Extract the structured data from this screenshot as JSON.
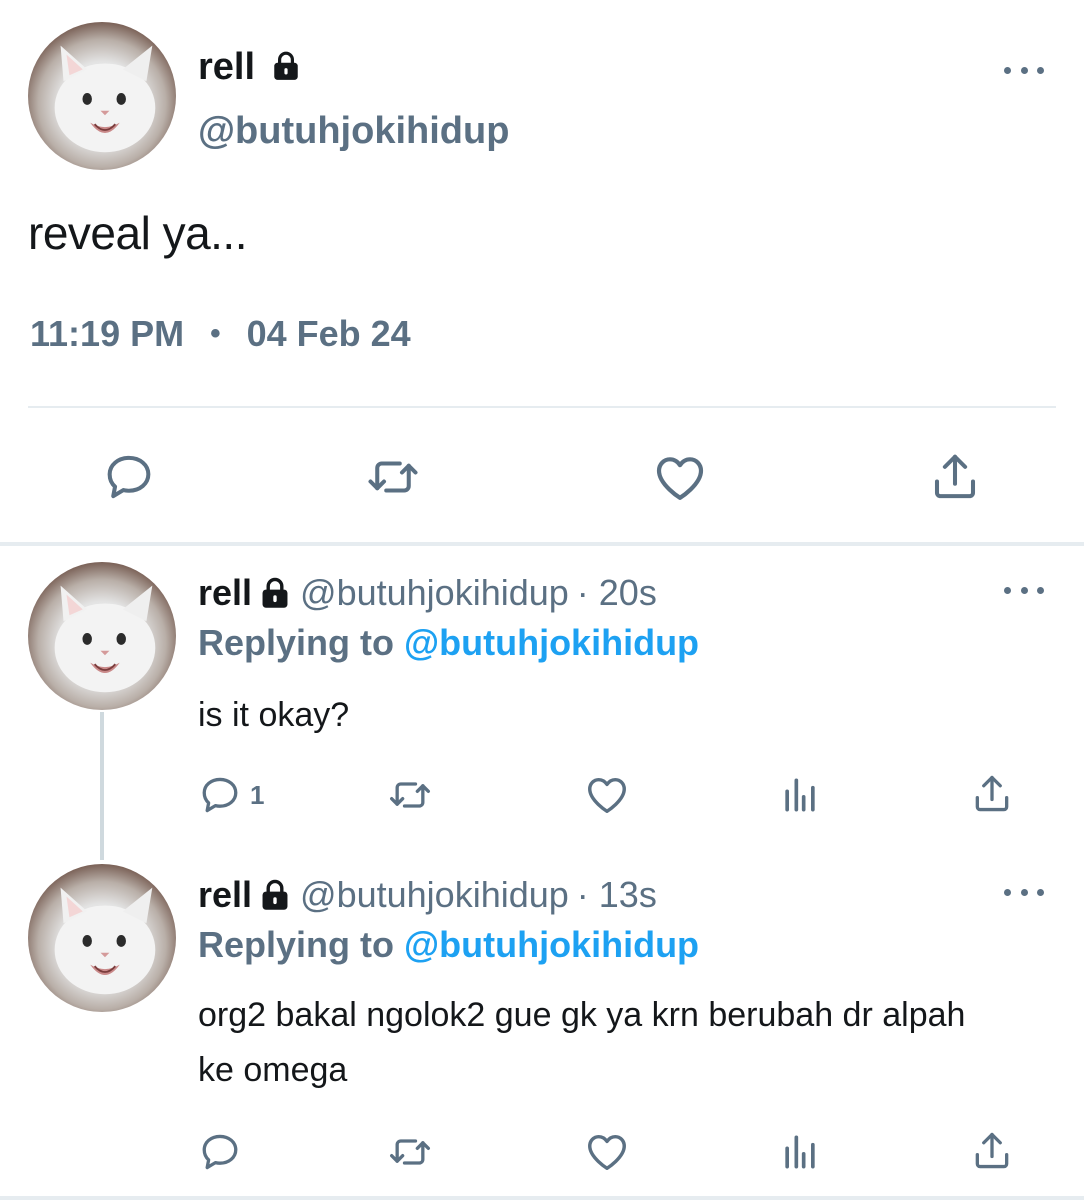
{
  "main_tweet": {
    "author_name": "rell",
    "author_handle": "@butuhjokihidup",
    "text": "reveal ya...",
    "time": "11:19 PM",
    "separator": "•",
    "date": "04 Feb 24",
    "actions": [
      "reply-icon",
      "retweet-icon",
      "like-icon",
      "share-icon"
    ]
  },
  "replies": [
    {
      "author_name": "rell",
      "author_handle": "@butuhjokihidup",
      "age": "· 20s",
      "replying_prefix": "Replying to",
      "replying_mention": "@butuhjokihidup",
      "text": "is it okay?",
      "reply_count": "1"
    },
    {
      "author_name": "rell",
      "author_handle": "@butuhjokihidup",
      "age": "· 13s",
      "replying_prefix": "Replying to",
      "replying_mention": "@butuhjokihidup",
      "text": "org2 bakal ngolok2 gue gk ya krn berubah dr alpah ke omega",
      "reply_count": ""
    }
  ],
  "colors": {
    "text": "#14171a",
    "muted": "#5b7083",
    "link": "#1da1f2",
    "divider": "#e6ecf0"
  }
}
